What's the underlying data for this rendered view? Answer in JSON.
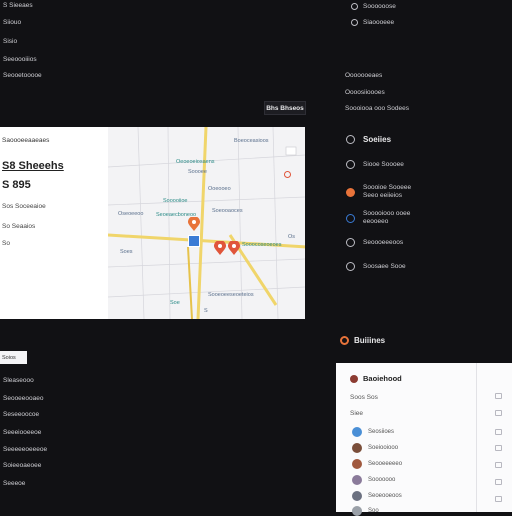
{
  "left_top": [
    "S Sieeaes",
    "Siiouo",
    "Sisio",
    "Seeoooiiios",
    "Seooetooooe"
  ],
  "top_right": [
    "Soooooose",
    "Siaoooeee"
  ],
  "right_links": [
    "Ooooooeaes",
    "Oooosiioooes",
    "Soooiooa ooo Sodees"
  ],
  "filter_button": "Bhs Bhseos",
  "card": {
    "title": "S8 Sheeehs",
    "price": "S 895",
    "details": [
      "Sos Soceeaioe",
      "So Seaaios",
      "So"
    ],
    "lines": [
      "Saoooeeaaeaes"
    ]
  },
  "map_labels": [
    "Boeoceasioos",
    "Oeoeoeiosaens",
    "Soooee",
    "Ooeooeo",
    "Sooooiioe",
    "Soeooaoces",
    "Seoeaecboneoo",
    "Oseoeeoo",
    "Soes",
    "Sooocoseoeoes",
    "Sooeoeeseoeteios",
    "Soe",
    "S",
    "Os"
  ],
  "options_title": "Soeiies",
  "options": [
    "Siooe Soooee",
    "Soooioe Sooeee Seeo eeiieios",
    "Sooooiooo ooee eeooeeo",
    "Seoooeeeoos",
    "Soosaee Sooe"
  ],
  "section_title": "Buiiines",
  "panel": {
    "title": "Baoiehood",
    "sub": [
      "Soos Sos",
      "Siee"
    ],
    "contacts": [
      "Seosiioes",
      "Soeiooiooo",
      "Seooeeeeeo",
      "Sooooooo",
      "Seoeooeoos",
      "Soo"
    ]
  },
  "left_bottom": [
    "Sleaseooo",
    "Seooeeooaeo",
    "Seseeoocoe",
    "Seeeiooeeoe",
    "Seeeeeoeeeoe",
    "Soieeoaeoee",
    "Seeeoe"
  ],
  "small_chip": "Soios",
  "colors": {
    "accent": "#e8733a",
    "road": "#f0d56a",
    "pin": "#e0553a",
    "bg": "#111114"
  }
}
